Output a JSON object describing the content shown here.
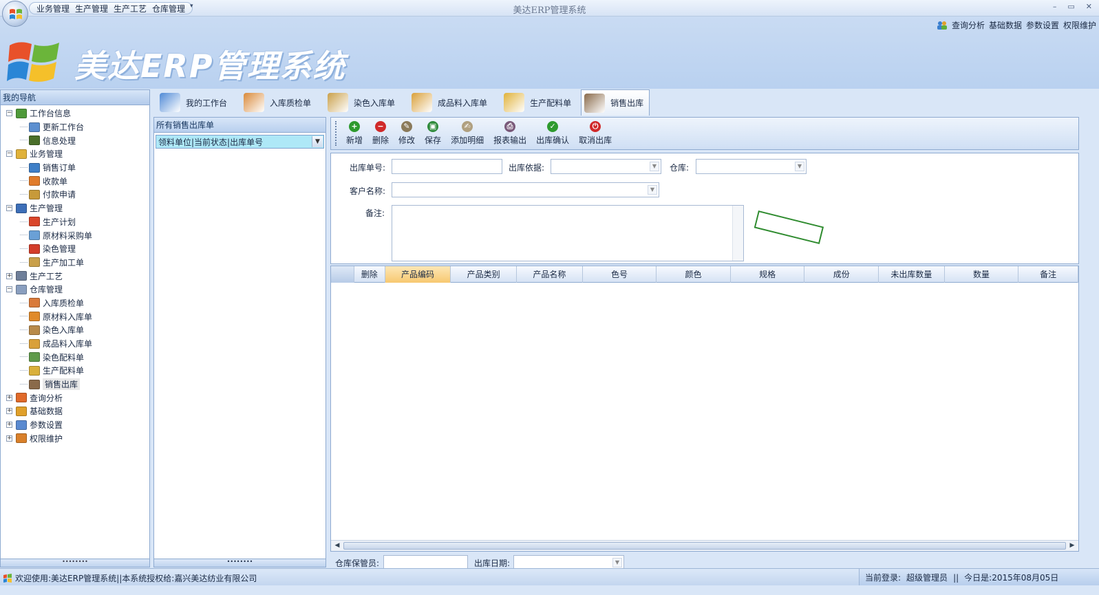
{
  "window": {
    "title": "美达ERP管理系统",
    "quick_access": [
      "业务管理",
      "生产管理",
      "生产工艺",
      "仓库管理"
    ],
    "controls": [
      "–",
      "▭",
      "✕"
    ]
  },
  "top_links": [
    "查询分析",
    "基础数据",
    "参数设置",
    "权限维护"
  ],
  "banner_title": "美达ERP管理系统",
  "nav": {
    "title": "我的导航",
    "groups": [
      {
        "label": "工作台信息",
        "icon_color": "#4f9a3a",
        "items": [
          {
            "label": "更新工作台",
            "icon_color": "#5b8fd0"
          },
          {
            "label": "信息处理",
            "icon_color": "#4a6f2a"
          }
        ]
      },
      {
        "label": "业务管理",
        "icon_color": "#e0b23a",
        "items": [
          {
            "label": "销售订单",
            "icon_color": "#3f7fc7"
          },
          {
            "label": "收款单",
            "icon_color": "#e07b2a"
          },
          {
            "label": "付款申请",
            "icon_color": "#c79a3a"
          }
        ]
      },
      {
        "label": "生产管理",
        "icon_color": "#3d6fb8",
        "items": [
          {
            "label": "生产计划",
            "icon_color": "#d9452a"
          },
          {
            "label": "原材料采购单",
            "icon_color": "#6aa0d6"
          },
          {
            "label": "染色管理",
            "icon_color": "#d33d2a"
          },
          {
            "label": "生产加工单",
            "icon_color": "#c9a04a"
          }
        ]
      },
      {
        "label": "生产工艺",
        "icon_color": "#6f7f99",
        "items": []
      },
      {
        "label": "仓库管理",
        "icon_color": "#8a9fbf",
        "items": [
          {
            "label": "入库质检单",
            "icon_color": "#d97a3a"
          },
          {
            "label": "原材料入库单",
            "icon_color": "#e08a2a"
          },
          {
            "label": "染色入库单",
            "icon_color": "#b88a4a"
          },
          {
            "label": "成品料入库单",
            "icon_color": "#d9a03a"
          },
          {
            "label": "染色配料单",
            "icon_color": "#5f9a4a"
          },
          {
            "label": "生产配料单",
            "icon_color": "#d9b03a"
          },
          {
            "label": "销售出库",
            "icon_color": "#8a6a4a",
            "selected": true
          }
        ]
      },
      {
        "label": "查询分析",
        "icon_color": "#e06a2a",
        "items": []
      },
      {
        "label": "基础数据",
        "icon_color": "#e0a02a",
        "items": []
      },
      {
        "label": "参数设置",
        "icon_color": "#5a8ad0",
        "items": []
      },
      {
        "label": "权限维护",
        "icon_color": "#d9802a",
        "items": []
      }
    ]
  },
  "tabs": [
    {
      "label": "我的工作台",
      "icon_color": "#4f8ad6"
    },
    {
      "label": "入库质检单",
      "icon_color": "#d98a3a"
    },
    {
      "label": "染色入库单",
      "icon_color": "#c9a04a"
    },
    {
      "label": "成品料入库单",
      "icon_color": "#d9a03a"
    },
    {
      "label": "生产配料单",
      "icon_color": "#e0b23a"
    },
    {
      "label": "销售出库",
      "icon_color": "#8a6a4a",
      "active": true
    }
  ],
  "list_pane": {
    "title": "所有销售出库单",
    "filter_value": "领料单位|当前状态|出库单号"
  },
  "toolbar": [
    {
      "label": "新增",
      "icon": "add-icon",
      "color": "#2e9a2e",
      "glyph": "+"
    },
    {
      "label": "删除",
      "icon": "delete-icon",
      "color": "#d02a2a",
      "glyph": "−"
    },
    {
      "label": "修改",
      "icon": "edit-icon",
      "color": "#8a7a5a",
      "glyph": "✎"
    },
    {
      "label": "保存",
      "icon": "save-icon",
      "color": "#2e8a3a",
      "glyph": "▣"
    },
    {
      "label": "添加明细",
      "icon": "add-detail-icon",
      "color": "#b0a080",
      "glyph": "✍"
    },
    {
      "label": "报表输出",
      "icon": "print-icon",
      "color": "#7a5a7a",
      "glyph": "⎙"
    },
    {
      "label": "出库确认",
      "icon": "confirm-icon",
      "color": "#2e9a2e",
      "glyph": "✓"
    },
    {
      "label": "取消出库",
      "icon": "cancel-out-icon",
      "color": "#d02a2a",
      "glyph": "⏻"
    }
  ],
  "form": {
    "out_no_label": "出库单号:",
    "basis_label": "出库依据:",
    "warehouse_label": "仓库:",
    "customer_label": "客户名称:",
    "remark_label": "备注:"
  },
  "grid": {
    "columns": [
      "删除",
      "产品编码",
      "产品类别",
      "产品名称",
      "色号",
      "颜色",
      "规格",
      "成份",
      "未出库数量",
      "数量",
      "备注"
    ],
    "selected_column": 1,
    "rows": []
  },
  "bottom": {
    "keeper_label": "仓库保管员:",
    "date_label": "出库日期:"
  },
  "status": {
    "welcome": "欢迎使用:美达ERP管理系统||本系统授权给:嘉兴美达纺业有限公司",
    "current_login": "当前登录:",
    "user": "超级管理员",
    "sep": "||",
    "today": "今日是:2015年08月05日"
  },
  "colors": {
    "accent": "#8eaad0",
    "banner": "#c9dbf3",
    "selected_header": "#f7c870",
    "stamp": "#2e8b2e"
  }
}
